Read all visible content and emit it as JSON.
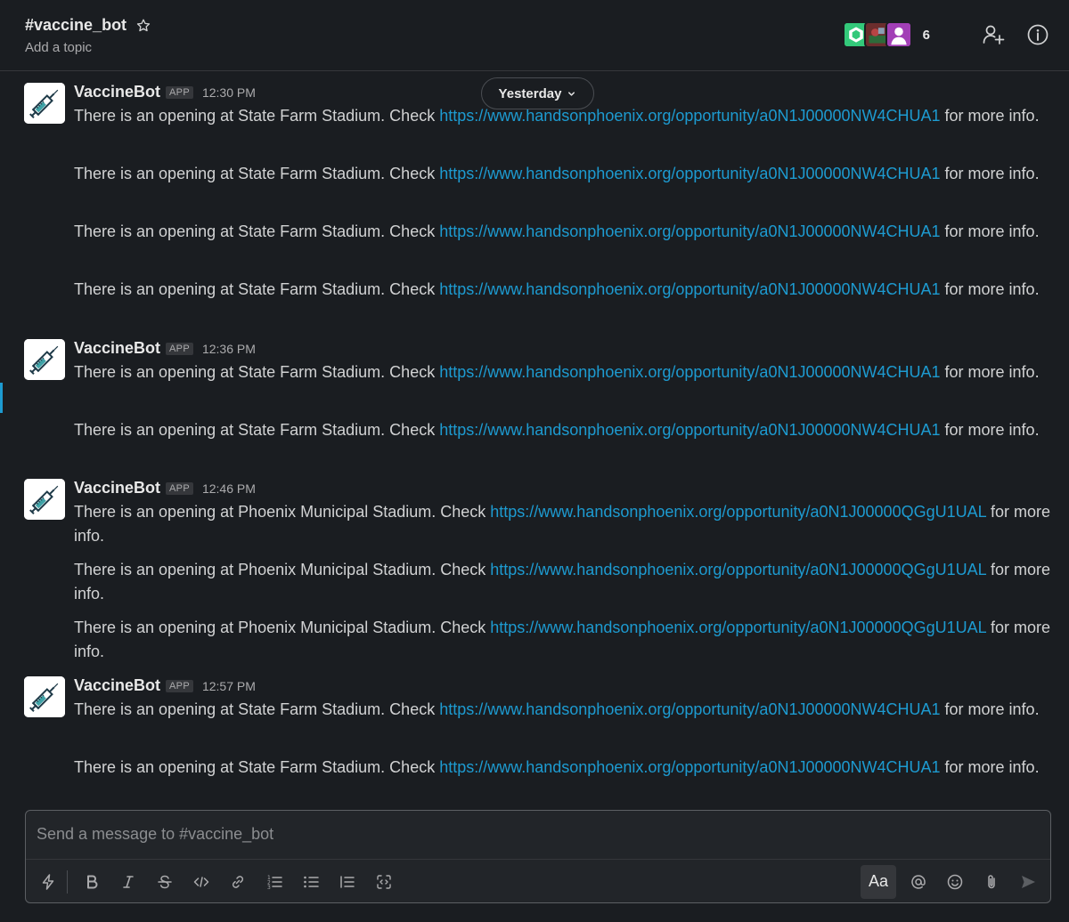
{
  "header": {
    "channel_name": "#vaccine_bot",
    "topic": "Add a topic",
    "member_count": "6"
  },
  "date_divider": {
    "label": "Yesterday"
  },
  "messages": [
    {
      "sender": "VaccineBot",
      "badge": "APP",
      "time": "12:30 PM",
      "lines": [
        {
          "before": "There is an opening at State Farm Stadium. Check ",
          "link": "https://www.handsonphoenix.org/opportunity/a0N1J00000NW4CHUA1",
          "after": " for more info."
        },
        {
          "before": "There is an opening at State Farm Stadium. Check ",
          "link": "https://www.handsonphoenix.org/opportunity/a0N1J00000NW4CHUA1",
          "after": " for more info."
        },
        {
          "before": "There is an opening at State Farm Stadium. Check ",
          "link": "https://www.handsonphoenix.org/opportunity/a0N1J00000NW4CHUA1",
          "after": " for more info."
        },
        {
          "before": "There is an opening at State Farm Stadium. Check ",
          "link": "https://www.handsonphoenix.org/opportunity/a0N1J00000NW4CHUA1",
          "after": " for more info."
        }
      ]
    },
    {
      "sender": "VaccineBot",
      "badge": "APP",
      "time": "12:36 PM",
      "lines": [
        {
          "before": "There is an opening at State Farm Stadium. Check ",
          "link": "https://www.handsonphoenix.org/opportunity/a0N1J00000NW4CHUA1",
          "after": " for more info."
        },
        {
          "before": "There is an opening at State Farm Stadium. Check ",
          "link": "https://www.handsonphoenix.org/opportunity/a0N1J00000NW4CHUA1",
          "after": " for more info."
        }
      ]
    },
    {
      "sender": "VaccineBot",
      "badge": "APP",
      "time": "12:46 PM",
      "lines": [
        {
          "before": "There is an opening at Phoenix Municipal Stadium. Check ",
          "link": "https://www.handsonphoenix.org/opportunity/a0N1J00000QGgU1UAL",
          "after": " for more info."
        },
        {
          "before": "There is an opening at Phoenix Municipal Stadium. Check ",
          "link": "https://www.handsonphoenix.org/opportunity/a0N1J00000QGgU1UAL",
          "after": " for more info."
        },
        {
          "before": "There is an opening at Phoenix Municipal Stadium. Check ",
          "link": "https://www.handsonphoenix.org/opportunity/a0N1J00000QGgU1UAL",
          "after": " for more info."
        }
      ]
    },
    {
      "sender": "VaccineBot",
      "badge": "APP",
      "time": "12:57 PM",
      "lines": [
        {
          "before": "There is an opening at State Farm Stadium. Check ",
          "link": "https://www.handsonphoenix.org/opportunity/a0N1J00000NW4CHUA1",
          "after": " for more info."
        },
        {
          "before": "There is an opening at State Farm Stadium. Check ",
          "link": "https://www.handsonphoenix.org/opportunity/a0N1J00000NW4CHUA1",
          "after": " for more info."
        }
      ]
    }
  ],
  "composer": {
    "placeholder": "Send a message to #vaccine_bot",
    "value": "",
    "format_button_label": "Aa"
  },
  "colors": {
    "background": "#1a1d21",
    "link": "#1d9bd1",
    "text": "#d1d2d3"
  },
  "icons": {
    "header": [
      "star-icon",
      "add-member-icon",
      "info-icon"
    ],
    "toolbar": [
      "shortcuts-icon",
      "bold-icon",
      "italic-icon",
      "strikethrough-icon",
      "code-icon",
      "link-icon",
      "ordered-list-icon",
      "bulleted-list-icon",
      "blockquote-icon",
      "code-block-icon",
      "mention-icon",
      "emoji-icon",
      "attachment-icon",
      "send-icon"
    ]
  }
}
